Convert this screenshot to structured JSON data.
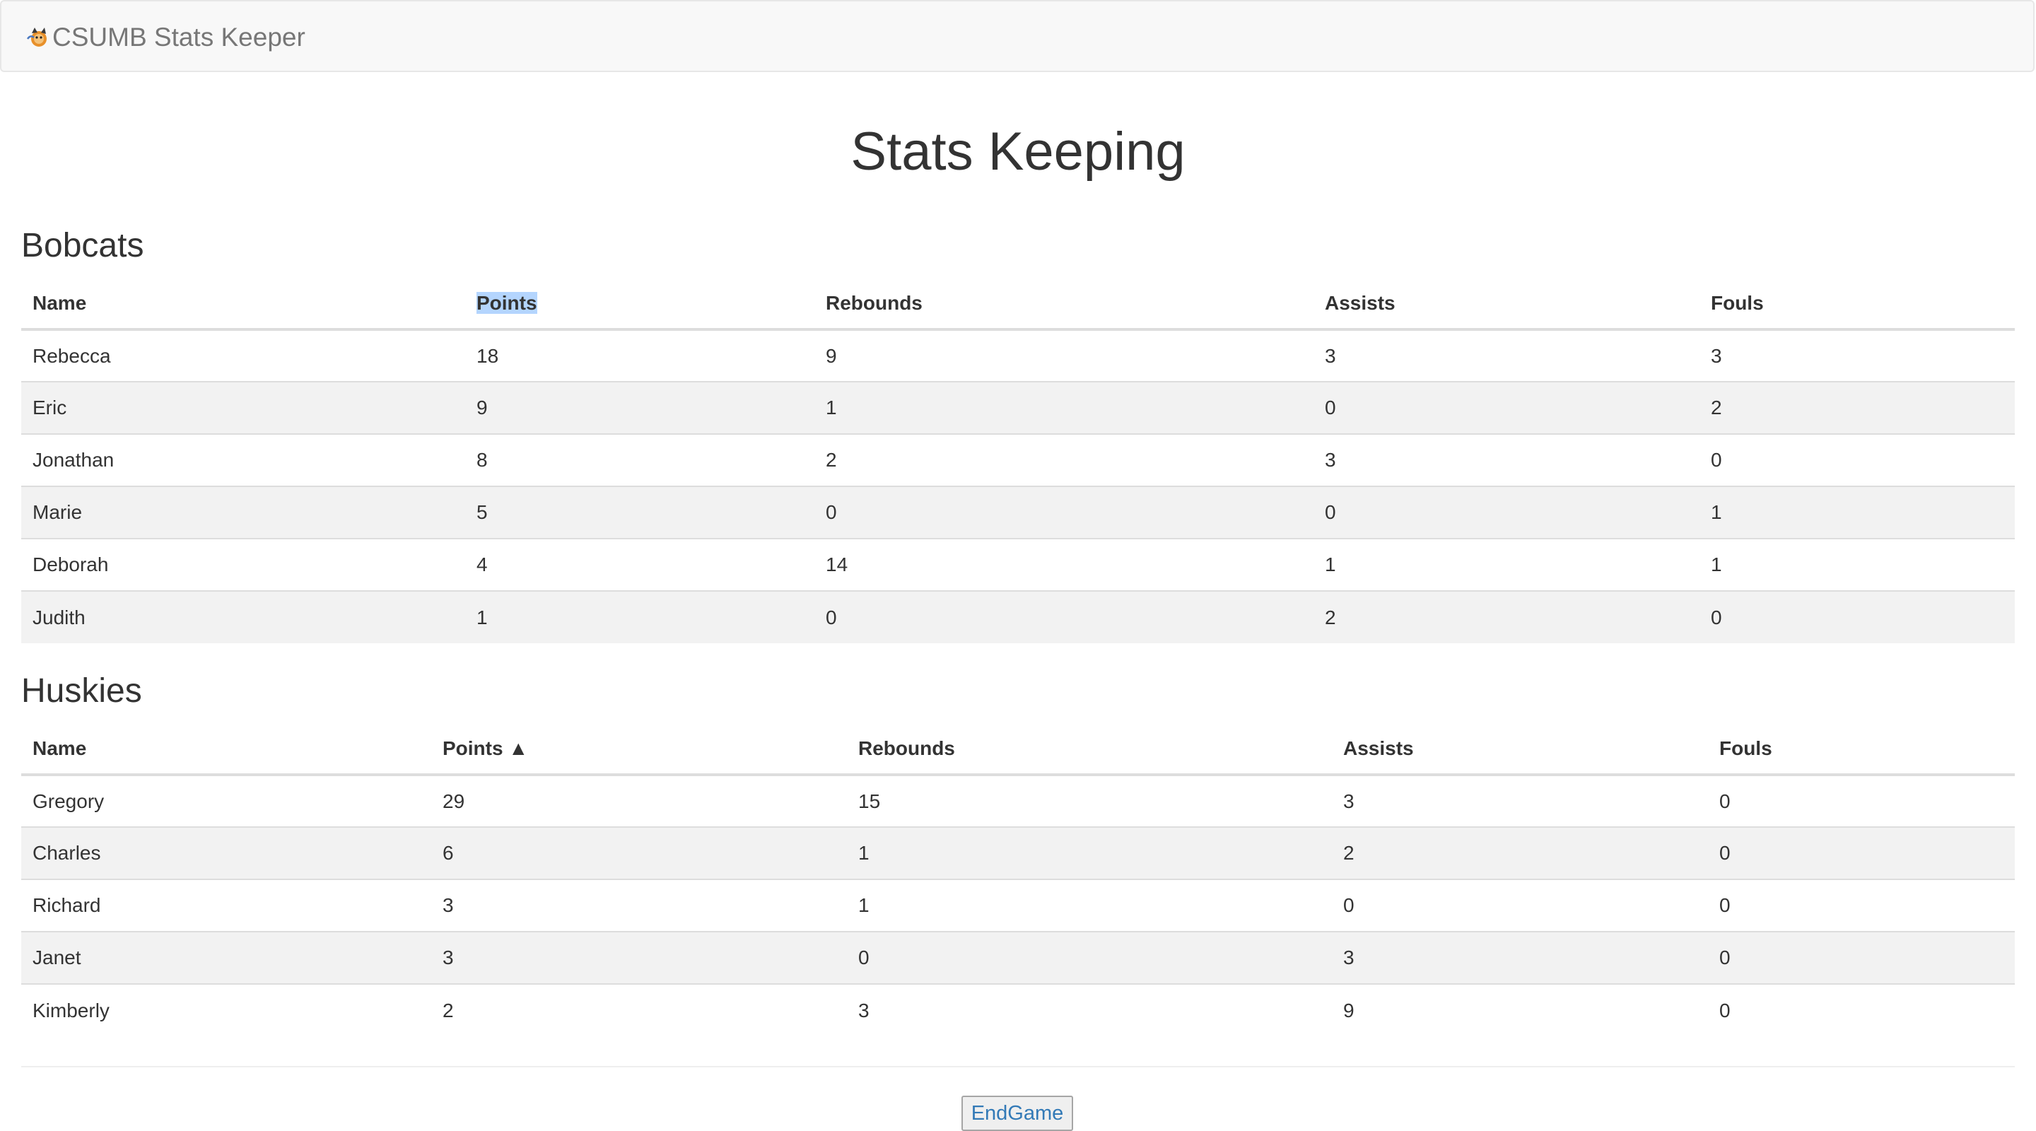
{
  "navbar": {
    "brand_text": "CSUMB Stats Keeper",
    "logo_icon": "bobcat-logo-icon"
  },
  "page": {
    "title": "Stats Keeping"
  },
  "teams": [
    {
      "name": "Bobcats",
      "headers": {
        "name": "Name",
        "points": "Points",
        "rebounds": "Rebounds",
        "assists": "Assists",
        "fouls": "Fouls"
      },
      "rows": [
        {
          "name": "Rebecca",
          "points": "18",
          "rebounds": "9",
          "assists": "3",
          "fouls": "3"
        },
        {
          "name": "Eric",
          "points": "9",
          "rebounds": "1",
          "assists": "0",
          "fouls": "2"
        },
        {
          "name": "Jonathan",
          "points": "8",
          "rebounds": "2",
          "assists": "3",
          "fouls": "0"
        },
        {
          "name": "Marie",
          "points": "5",
          "rebounds": "0",
          "assists": "0",
          "fouls": "1"
        },
        {
          "name": "Deborah",
          "points": "4",
          "rebounds": "14",
          "assists": "1",
          "fouls": "1"
        },
        {
          "name": "Judith",
          "points": "1",
          "rebounds": "0",
          "assists": "2",
          "fouls": "0"
        }
      ]
    },
    {
      "name": "Huskies",
      "headers": {
        "name": "Name",
        "points": "Points ▲",
        "rebounds": "Rebounds",
        "assists": "Assists",
        "fouls": "Fouls"
      },
      "rows": [
        {
          "name": "Gregory",
          "points": "29",
          "rebounds": "15",
          "assists": "3",
          "fouls": "0"
        },
        {
          "name": "Charles",
          "points": "6",
          "rebounds": "1",
          "assists": "2",
          "fouls": "0"
        },
        {
          "name": "Richard",
          "points": "3",
          "rebounds": "1",
          "assists": "0",
          "fouls": "0"
        },
        {
          "name": "Janet",
          "points": "3",
          "rebounds": "0",
          "assists": "3",
          "fouls": "0"
        },
        {
          "name": "Kimberly",
          "points": "2",
          "rebounds": "3",
          "assists": "9",
          "fouls": "0"
        }
      ]
    }
  ],
  "actions": {
    "end_game_label": "EndGame"
  },
  "colors": {
    "navbar_bg": "#f8f8f8",
    "brand_text": "#777777",
    "stripe_bg": "#f2f2f2",
    "selection_highlight": "#b4d5fe",
    "button_text": "#337ab7"
  }
}
